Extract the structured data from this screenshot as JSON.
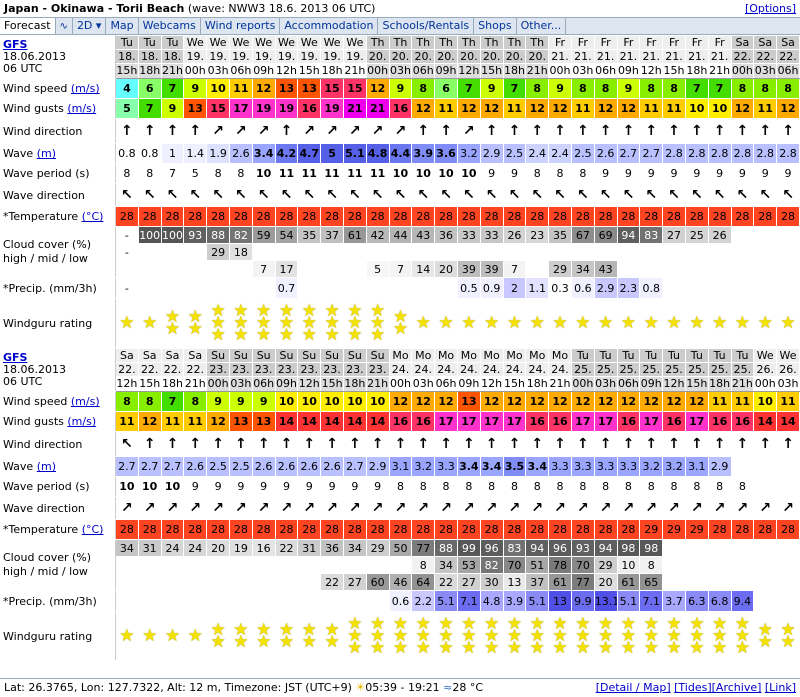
{
  "title": {
    "location": "Japan - Okinawa - Torii Beach",
    "wave": "(wave: NWW3 18.6. 2013 06 UTC)",
    "options": "[Options]"
  },
  "tabs": [
    "Forecast",
    "2D",
    "Map",
    "Webcams",
    "Wind reports",
    "Accommodation",
    "Schools/Rentals",
    "Shops",
    "Other..."
  ],
  "labels": {
    "wind_speed": "Wind speed",
    "wind_gusts": "Wind gusts",
    "ms": "(m/s)",
    "wind_dir": "Wind direction",
    "wave": "Wave",
    "m": "(m)",
    "wave_period": "Wave period (s)",
    "wave_dir": "Wave direction",
    "temperature": "*Temperature",
    "degc": "(°C)",
    "cloud1": "Cloud cover (%)",
    "cloud2": "high / mid / low",
    "precip": "*Precip. (mm/3h)",
    "rating": "Windguru rating"
  },
  "model": {
    "name": "GFS",
    "date": "18.06.2013",
    "time": "06 UTC"
  },
  "colors": {
    "wind_scale": [
      "#66ffff",
      "#88ff66",
      "#44dd00",
      "#ccff00",
      "#ffee00",
      "#ffaa00",
      "#ff5500",
      "#ff3366",
      "#ff33cc",
      "#ee00ee"
    ],
    "temp": "#ff4422",
    "accent_link": "#0000cc"
  },
  "tables": [
    {
      "days": [
        "Tu",
        "Tu",
        "Tu",
        "We",
        "We",
        "We",
        "We",
        "We",
        "We",
        "We",
        "We",
        "Th",
        "Th",
        "Th",
        "Th",
        "Th",
        "Th",
        "Th",
        "Th",
        "Fr",
        "Fr",
        "Fr",
        "Fr",
        "Fr",
        "Fr",
        "Fr",
        "Fr",
        "Sa",
        "Sa",
        "Sa"
      ],
      "dates": [
        "18.",
        "18.",
        "18.",
        "19.",
        "19.",
        "19.",
        "19.",
        "19.",
        "19.",
        "19.",
        "19.",
        "20.",
        "20.",
        "20.",
        "20.",
        "20.",
        "20.",
        "20.",
        "20.",
        "21.",
        "21.",
        "21.",
        "21.",
        "21.",
        "21.",
        "21.",
        "21.",
        "22.",
        "22.",
        "22."
      ],
      "times": [
        "15h",
        "18h",
        "21h",
        "00h",
        "03h",
        "06h",
        "09h",
        "12h",
        "15h",
        "18h",
        "21h",
        "00h",
        "03h",
        "06h",
        "09h",
        "12h",
        "15h",
        "18h",
        "21h",
        "00h",
        "03h",
        "06h",
        "09h",
        "12h",
        "15h",
        "18h",
        "21h",
        "00h",
        "03h",
        "06h"
      ],
      "dark": [
        1,
        1,
        1,
        0,
        0,
        0,
        0,
        0,
        0,
        0,
        0,
        1,
        1,
        1,
        1,
        1,
        1,
        1,
        1,
        0,
        0,
        0,
        0,
        0,
        0,
        0,
        0,
        1,
        1,
        1
      ],
      "speed": [
        "4",
        "6",
        "7",
        "9",
        "10",
        "11",
        "12",
        "13",
        "13",
        "15",
        "15",
        "12",
        "9",
        "8",
        "6",
        "7",
        "9",
        "7",
        "8",
        "9",
        "8",
        "8",
        "9",
        "8",
        "8",
        "7",
        "7",
        "8",
        "8",
        "8"
      ],
      "gusts": [
        "5",
        "7",
        "9",
        "13",
        "15",
        "17",
        "19",
        "19",
        "16",
        "19",
        "21",
        "21",
        "16",
        "12",
        "11",
        "12",
        "12",
        "11",
        "12",
        "12",
        "11",
        "12",
        "12",
        "11",
        "11",
        "10",
        "10",
        "12",
        "11",
        "12"
      ],
      "wdir": [
        "↑",
        "↑",
        "↑",
        "↑",
        "↗",
        "↗",
        "↗",
        "↑",
        "↗",
        "↗",
        "↗",
        "↗",
        "↗",
        "↑",
        "↑",
        "↗",
        "↑",
        "↑",
        "↑",
        "↑",
        "↑",
        "↑",
        "↑",
        "↑",
        "↑",
        "↑",
        "↑",
        "↑",
        "↑",
        "↑"
      ],
      "wave": [
        "0.8",
        "0.8",
        "1",
        "1.4",
        "1.9",
        "2.6",
        "3.4",
        "4.2",
        "4.7",
        "5",
        "5.1",
        "4.8",
        "4.4",
        "3.9",
        "3.6",
        "3.2",
        "2.9",
        "2.5",
        "2.4",
        "2.4",
        "2.5",
        "2.6",
        "2.7",
        "2.7",
        "2.8",
        "2.8",
        "2.8",
        "2.8",
        "2.8",
        "2.8"
      ],
      "period": [
        "8",
        "8",
        "7",
        "5",
        "8",
        "8",
        "10",
        "11",
        "11",
        "11",
        "11",
        "11",
        "10",
        "10",
        "10",
        "10",
        "9",
        "9",
        "8",
        "8",
        "8",
        "9",
        "9",
        "9",
        "9",
        "9",
        "9",
        "9",
        "9",
        "9"
      ],
      "wavedir": [
        "↖",
        "↖",
        "↖",
        "↖",
        "↖",
        "↖",
        "↖",
        "↖",
        "↖",
        "↖",
        "↖",
        "↖",
        "↖",
        "↖",
        "↖",
        "↖",
        "↖",
        "↖",
        "↖",
        "↖",
        "↖",
        "↖",
        "↖",
        "↖",
        "↖",
        "↖",
        "↖",
        "↖",
        "↖",
        "↖"
      ],
      "temp": [
        "28",
        "28",
        "28",
        "28",
        "28",
        "28",
        "28",
        "28",
        "28",
        "28",
        "28",
        "28",
        "28",
        "28",
        "28",
        "28",
        "28",
        "28",
        "28",
        "28",
        "28",
        "28",
        "28",
        "28",
        "28",
        "28",
        "28",
        "28",
        "28",
        "28"
      ],
      "cloud_high": [
        "-",
        "100",
        "100",
        "93",
        "88",
        "82",
        "59",
        "54",
        "35",
        "37",
        "61",
        "42",
        "44",
        "43",
        "36",
        "33",
        "33",
        "26",
        "23",
        "35",
        "67",
        "69",
        "94",
        "83",
        "27",
        "25",
        "26",
        "",
        "",
        ""
      ],
      "cloud_mid": [
        "-",
        "",
        "",
        "",
        "29",
        "18",
        "",
        "",
        "",
        "",
        "",
        "",
        "",
        "",
        "",
        "",
        "",
        "",
        "",
        "",
        "",
        "",
        "",
        "",
        "",
        "",
        "",
        "",
        "",
        ""
      ],
      "cloud_low": [
        "",
        "",
        "",
        "",
        "",
        "",
        "7",
        "17",
        "",
        "",
        "",
        "5",
        "7",
        "14",
        "20",
        "39",
        "39",
        "7",
        "",
        "29",
        "34",
        "43",
        "",
        "",
        "",
        "",
        "",
        "",
        "",
        ""
      ],
      "precip": [
        "-",
        "",
        "",
        "",
        "",
        "",
        "",
        "0.7",
        "",
        "",
        "",
        "",
        "",
        "",
        "",
        "0.5",
        "0.9",
        "2",
        "1.1",
        "0.3",
        "0.6",
        "2.9",
        "2.3",
        "0.8",
        "",
        "",
        "",
        "",
        "",
        ""
      ],
      "rating": [
        1,
        1,
        2,
        2,
        3,
        3,
        3,
        3,
        3,
        3,
        3,
        3,
        2,
        1,
        1,
        1,
        1,
        1,
        1,
        1,
        1,
        1,
        1,
        1,
        1,
        1,
        1,
        1,
        1,
        1
      ]
    },
    {
      "days": [
        "Sa",
        "Sa",
        "Sa",
        "Sa",
        "Su",
        "Su",
        "Su",
        "Su",
        "Su",
        "Su",
        "Su",
        "Su",
        "Mo",
        "Mo",
        "Mo",
        "Mo",
        "Mo",
        "Mo",
        "Mo",
        "Mo",
        "Tu",
        "Tu",
        "Tu",
        "Tu",
        "Tu",
        "Tu",
        "Tu",
        "Tu",
        "We",
        "We"
      ],
      "dates": [
        "22.",
        "22.",
        "22.",
        "22.",
        "23.",
        "23.",
        "23.",
        "23.",
        "23.",
        "23.",
        "23.",
        "23.",
        "24.",
        "24.",
        "24.",
        "24.",
        "24.",
        "24.",
        "24.",
        "24.",
        "25.",
        "25.",
        "25.",
        "25.",
        "25.",
        "25.",
        "25.",
        "25.",
        "26.",
        "26."
      ],
      "times": [
        "12h",
        "15h",
        "18h",
        "21h",
        "00h",
        "03h",
        "06h",
        "09h",
        "12h",
        "15h",
        "18h",
        "21h",
        "00h",
        "03h",
        "06h",
        "09h",
        "12h",
        "15h",
        "18h",
        "21h",
        "00h",
        "03h",
        "06h",
        "09h",
        "12h",
        "15h",
        "18h",
        "21h",
        "00h",
        "03h"
      ],
      "dark": [
        0,
        0,
        0,
        0,
        1,
        1,
        1,
        1,
        1,
        1,
        1,
        1,
        0,
        0,
        0,
        0,
        0,
        0,
        0,
        0,
        1,
        1,
        1,
        1,
        1,
        1,
        1,
        1,
        0,
        0
      ],
      "speed": [
        "8",
        "8",
        "7",
        "8",
        "9",
        "9",
        "9",
        "10",
        "10",
        "10",
        "10",
        "10",
        "12",
        "12",
        "12",
        "13",
        "12",
        "12",
        "12",
        "12",
        "12",
        "12",
        "12",
        "12",
        "12",
        "12",
        "11",
        "11",
        "10",
        "11"
      ],
      "gusts": [
        "11",
        "12",
        "11",
        "11",
        "12",
        "13",
        "13",
        "14",
        "14",
        "14",
        "14",
        "14",
        "16",
        "16",
        "17",
        "17",
        "17",
        "17",
        "16",
        "16",
        "17",
        "17",
        "16",
        "17",
        "16",
        "17",
        "16",
        "16",
        "14",
        "14"
      ],
      "wdir": [
        "↖",
        "↑",
        "↑",
        "↑",
        "↑",
        "↑",
        "↑",
        "↑",
        "↑",
        "↑",
        "↑",
        "↑",
        "↑",
        "↑",
        "↑",
        "↑",
        "↑",
        "↑",
        "↑",
        "↑",
        "↑",
        "↑",
        "↑",
        "↑",
        "↑",
        "↑",
        "↑",
        "↑",
        "↑",
        "↑"
      ],
      "wave": [
        "2.7",
        "2.7",
        "2.7",
        "2.6",
        "2.5",
        "2.5",
        "2.6",
        "2.6",
        "2.6",
        "2.6",
        "2.7",
        "2.9",
        "3.1",
        "3.2",
        "3.3",
        "3.4",
        "3.4",
        "3.5",
        "3.4",
        "3.3",
        "3.3",
        "3.3",
        "3.3",
        "3.2",
        "3.2",
        "3.1",
        "2.9",
        "",
        "",
        ""
      ],
      "period": [
        "10",
        "10",
        "10",
        "9",
        "9",
        "9",
        "9",
        "9",
        "9",
        "9",
        "9",
        "9",
        "8",
        "8",
        "8",
        "8",
        "8",
        "8",
        "8",
        "8",
        "8",
        "8",
        "8",
        "8",
        "8",
        "8",
        "8",
        "8",
        "",
        ""
      ],
      "wavedir": [
        "↗",
        "↗",
        "↗",
        "↗",
        "↗",
        "↗",
        "↗",
        "↗",
        "↗",
        "↗",
        "↗",
        "↗",
        "↗",
        "↗",
        "↗",
        "↗",
        "↗",
        "↗",
        "↗",
        "↗",
        "↗",
        "↗",
        "↗",
        "↗",
        "↗",
        "↗",
        "↗",
        "↗",
        "↗",
        "↗"
      ],
      "temp": [
        "28",
        "28",
        "28",
        "28",
        "28",
        "28",
        "28",
        "28",
        "28",
        "28",
        "28",
        "28",
        "28",
        "28",
        "28",
        "28",
        "28",
        "28",
        "28",
        "28",
        "28",
        "28",
        "28",
        "29",
        "29",
        "29",
        "28",
        "28",
        "28",
        "28"
      ],
      "cloud_high": [
        "34",
        "31",
        "24",
        "24",
        "20",
        "19",
        "16",
        "22",
        "31",
        "36",
        "34",
        "29",
        "50",
        "77",
        "88",
        "99",
        "96",
        "83",
        "94",
        "96",
        "93",
        "94",
        "98",
        "98",
        "",
        "",
        "",
        "",
        "",
        ""
      ],
      "cloud_mid": [
        "",
        "",
        "",
        "",
        "",
        "",
        "",
        "",
        "",
        "",
        "",
        "",
        "",
        "8",
        "34",
        "53",
        "82",
        "70",
        "51",
        "78",
        "70",
        "29",
        "10",
        "8",
        "",
        "",
        "",
        "",
        "",
        ""
      ],
      "cloud_low": [
        "",
        "",
        "",
        "",
        "",
        "",
        "",
        "",
        "",
        "22",
        "27",
        "60",
        "46",
        "64",
        "22",
        "27",
        "30",
        "13",
        "37",
        "61",
        "77",
        "20",
        "61",
        "65",
        "",
        "",
        "",
        "",
        "",
        ""
      ],
      "precip": [
        "",
        "",
        "",
        "",
        "",
        "",
        "",
        "",
        "",
        "",
        "",
        "",
        "0.6",
        "2.2",
        "5.1",
        "7.1",
        "4.8",
        "3.9",
        "5.1",
        "13",
        "9.9",
        "13.1",
        "5.1",
        "7.1",
        "3.7",
        "6.3",
        "6.8",
        "9.4",
        "",
        ""
      ],
      "rating": [
        1,
        1,
        1,
        1,
        2,
        2,
        2,
        2,
        2,
        2,
        3,
        3,
        3,
        3,
        3,
        3,
        3,
        3,
        3,
        3,
        3,
        3,
        3,
        3,
        3,
        3,
        3,
        3,
        2,
        2
      ]
    }
  ],
  "footer": {
    "coords": "Lat: 26.3765, Lon: 127.7322, Alt: 12 m, Timezone: JST (UTC+9)",
    "sun": "05:39 - 19:21",
    "water": "28 °C",
    "links": [
      "[Detail / Map]",
      "[Tides]",
      "[Archive]",
      "[Link]"
    ]
  }
}
